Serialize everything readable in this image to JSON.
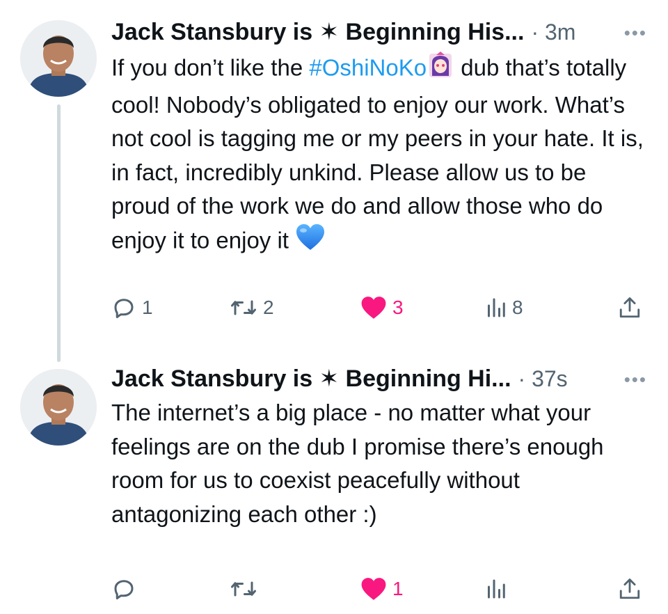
{
  "tweets": [
    {
      "author": "Jack Stansbury is ✶ Beginning His...",
      "time_sep": "·",
      "time": "3m",
      "more": "•••",
      "text_before": "If you don’t like the ",
      "hashtag": "#OshiNoKo",
      "hashtag_emoji": "anime-character-emoji",
      "text_after": " dub that’s totally cool! Nobody’s obligated to enjoy our work. What’s not cool is tagging me or my peers in your hate. It is, in fact, incredibly unkind. Please allow us to be proud of the work we do and allow those who do enjoy it to enjoy it ",
      "text_emoji": "blue-heart-emoji",
      "reply_count": "1",
      "retweet_count": "2",
      "like_count": "3",
      "view_count": "8"
    },
    {
      "author": "Jack Stansbury is ✶ Beginning Hi...",
      "time_sep": "·",
      "time": "37s",
      "more": "•••",
      "text": "The internet’s a big place - no matter what your feelings are on the dub I promise there’s enough room for us to coexist peacefully without antagonizing each other :)",
      "reply_count": "",
      "retweet_count": "",
      "like_count": "1",
      "view_count": ""
    }
  ],
  "colors": {
    "text": "#0f1419",
    "secondary": "#536471",
    "hashtag": "#1d9bf0",
    "like": "#f91880",
    "thread_line": "#cfd9de"
  },
  "icons": [
    "reply-icon",
    "retweet-icon",
    "like-icon",
    "views-icon",
    "share-icon",
    "more-icon"
  ]
}
